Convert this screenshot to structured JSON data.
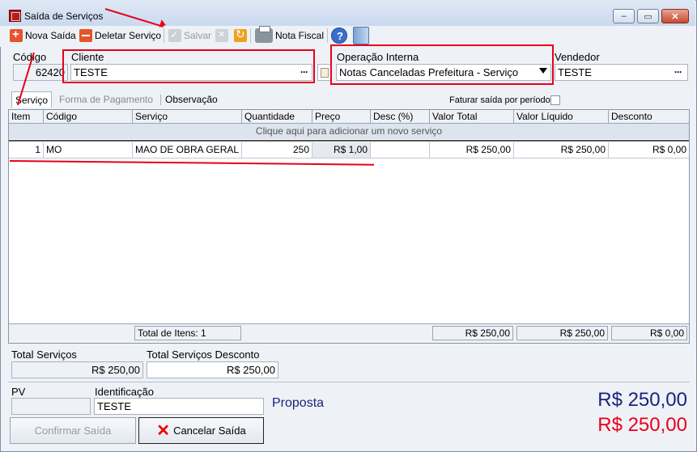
{
  "window": {
    "title": "Saída de Serviços",
    "minimize": "–",
    "maximize": "▭",
    "close": "✕"
  },
  "toolbar": {
    "nova_saida": "Nova Saída",
    "deletar_servico": "Deletar Serviço",
    "salvar": "Salvar",
    "nota_fiscal": "Nota Fiscal"
  },
  "header": {
    "codigo_label": "Código",
    "codigo_value": "62420",
    "cliente_label": "Cliente",
    "cliente_value": "TESTE",
    "operacao_label": "Operação Interna",
    "operacao_value": "Notas Canceladas Prefeitura - Serviço",
    "vendedor_label": "Vendedor",
    "vendedor_value": "TESTE",
    "ellipsis": "···"
  },
  "tabs": [
    {
      "label": "Serviço"
    },
    {
      "label": "Forma de Pagamento"
    },
    {
      "label": "Observação"
    }
  ],
  "faturar_label": "Faturar saída por período",
  "grid": {
    "columns": [
      "Item",
      "Código",
      "Serviço",
      "Quantidade",
      "Preço",
      "Desc (%)",
      "Valor Total",
      "Valor Líquido",
      "Desconto"
    ],
    "add_row_text": "Clique aqui para adicionar um novo serviço",
    "rows": [
      {
        "item": "1",
        "codigo": "MO",
        "servico": "MAO DE OBRA GERAL",
        "quantidade": "250",
        "preco": "R$ 1,00",
        "desc": "",
        "valor_total": "R$ 250,00",
        "valor_liquido": "R$ 250,00",
        "desconto": "R$ 0,00"
      }
    ],
    "footer": {
      "total_itens": "Total de Itens: 1",
      "valor_total": "R$ 250,00",
      "valor_liquido": "R$ 250,00",
      "desconto": "R$ 0,00"
    }
  },
  "totals": {
    "total_servicos_label": "Total Serviços",
    "total_servicos_value": "R$ 250,00",
    "total_desconto_label": "Total Serviços Desconto",
    "total_desconto_value": "R$ 250,00"
  },
  "bottom": {
    "pv_label": "PV",
    "pv_value": "",
    "identificacao_label": "Identificação",
    "identificacao_value": "TESTE",
    "proposta": "Proposta",
    "grand_total_blue": "R$ 250,00",
    "grand_total_red": "R$ 250,00",
    "confirmar": "Confirmar Saída",
    "cancelar": "Cancelar Saída"
  },
  "colors": {
    "accent_blue": "#1a237e",
    "red": "#e8001c",
    "annotation": "#e8001c"
  }
}
